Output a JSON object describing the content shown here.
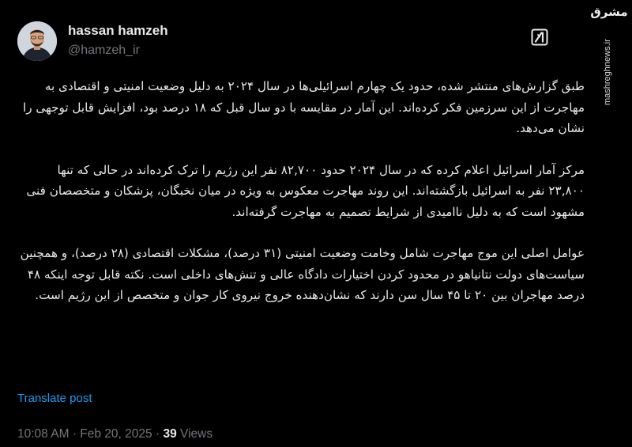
{
  "author": {
    "display_name": "hassan hamzeh",
    "handle": "@hamzeh_ir"
  },
  "icons": {
    "avatar": "profile-photo",
    "grok": "grok-icon"
  },
  "watermark": {
    "logo_text": "مشرق",
    "url_text": "mashreghnews.ir"
  },
  "post": {
    "paragraphs": [
      "طبق گزارش‌های منتشر شده، حدود یک چهارم اسرائیلی‌ها در سال ۲۰۲۴ به دلیل وضعیت امنیتی و اقتصادی به مهاجرت از این سرزمین فکر کرده‌اند. این آمار در مقایسه با دو سال قبل که ۱۸ درصد بود، افزایش قابل توجهی را نشان می‌دهد.",
      "مرکز آمار اسرائیل اعلام کرده که در سال ۲۰۲۴ حدود ۸۲,۷۰۰ نفر این رژیم را ترک کرده‌اند در حالی که تنها ۲۳,۸۰۰ نفر به اسرائیل بازگشته‌اند. این روند مهاجرت معکوس به ویژه در میان نخبگان، پزشکان و متخصصان فنی مشهود است که به دلیل ناامیدی از شرایط تصمیم به مهاجرت گرفته‌اند.",
      "عوامل اصلی این موج مهاجرت شامل وخامت وضعیت امنیتی (۳۱ درصد)، مشکلات اقتصادی (۲۸ درصد)، و همچنین سیاست‌های دولت نتانیاهو در محدود کردن اختیارات دادگاه عالی و تنش‌های داخلی است. نکته قابل توجه اینکه ۴۸ درصد مهاجران بین ۲۰ تا ۴۵ سال سن دارند که نشان‌دهنده خروج نیروی کار جوان و متخصص از این رژیم است."
    ],
    "translate_label": "Translate post",
    "time": "10:08 AM",
    "separator": "·",
    "date": "Feb 20, 2025",
    "views_count": "39",
    "views_label": "Views"
  }
}
